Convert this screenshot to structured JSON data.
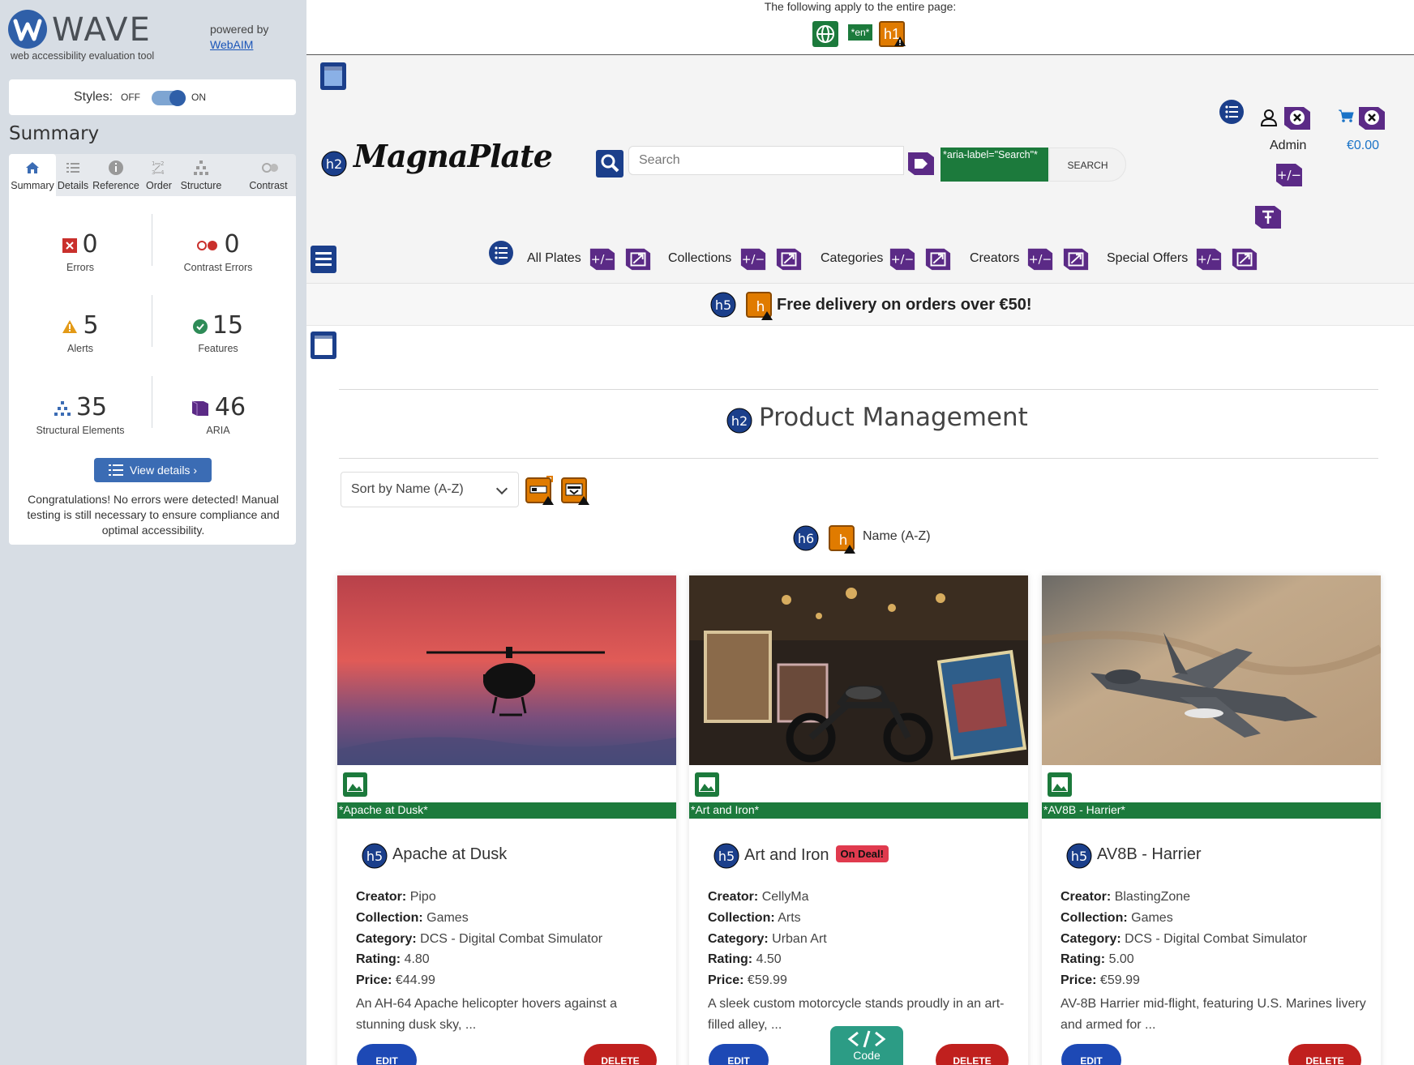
{
  "wave": {
    "title": "WAVE",
    "subtitle": "web accessibility evaluation tool",
    "powered_by": "powered by",
    "webaim": "WebAIM",
    "styles_label": "Styles:",
    "styles_off": "OFF",
    "styles_on": "ON",
    "summary_heading": "Summary",
    "tabs": [
      "Summary",
      "Details",
      "Reference",
      "Order",
      "Structure",
      "Contrast"
    ],
    "stats": {
      "errors": {
        "value": "0",
        "label": "Errors"
      },
      "contrast": {
        "value": "0",
        "label": "Contrast Errors"
      },
      "alerts": {
        "value": "5",
        "label": "Alerts"
      },
      "features": {
        "value": "15",
        "label": "Features"
      },
      "structural": {
        "value": "35",
        "label": "Structural Elements"
      },
      "aria": {
        "value": "46",
        "label": "ARIA"
      }
    },
    "view_details": "View details ›",
    "congrats": "Congratulations! No errors were detected! Manual testing is still necessary to ensure compliance and optimal accessibility.",
    "colors": {
      "accent": "#2f5fa8",
      "bg": "#d7dde4"
    }
  },
  "page": {
    "apply_text": "The following apply to the entire page:",
    "lang_tag": "*en*",
    "h1_tag": "h1",
    "logo": "MagnaPlate",
    "search_placeholder": "Search",
    "aria_label": "*aria-label=\"Search\"*",
    "search_button": "SEARCH",
    "admin_label": "Admin",
    "cart_total": "€0.00",
    "nav": [
      "All Plates",
      "Collections",
      "Categories",
      "Creators",
      "Special Offers"
    ],
    "promo": "Free delivery on orders over €50!",
    "product_heading": "Product Management",
    "sort_value": "Sort by Name (A-Z)",
    "sorted_label": "Name (A-Z)",
    "code_button": "Code",
    "labels": {
      "creator": "Creator:",
      "collection": "Collection:",
      "category": "Category:",
      "rating": "Rating:",
      "price": "Price:",
      "edit": "EDIT",
      "delete": "DELETE"
    },
    "products": [
      {
        "alt": "*Apache at Dusk*",
        "title": "Apache at Dusk",
        "badge": "",
        "creator": "Pipo",
        "collection": "Games",
        "category": "DCS - Digital Combat Simulator",
        "rating": "4.80",
        "price": "€44.99",
        "desc": "An AH-64 Apache helicopter hovers against a stunning dusk sky, ..."
      },
      {
        "alt": "*Art and Iron*",
        "title": "Art and Iron",
        "badge": "On Deal!",
        "creator": "CellyMa",
        "collection": "Arts",
        "category": "Urban Art",
        "rating": "4.50",
        "price": "€59.99",
        "desc": "A sleek custom motorcycle stands proudly in an art-filled alley, ..."
      },
      {
        "alt": "*AV8B - Harrier*",
        "title": "AV8B - Harrier",
        "badge": "",
        "creator": "BlastingZone",
        "collection": "Games",
        "category": "DCS - Digital Combat Simulator",
        "rating": "5.00",
        "price": "€59.99",
        "desc": "AV-8B Harrier mid-flight, featuring U.S. Marines livery and armed for ..."
      }
    ]
  }
}
